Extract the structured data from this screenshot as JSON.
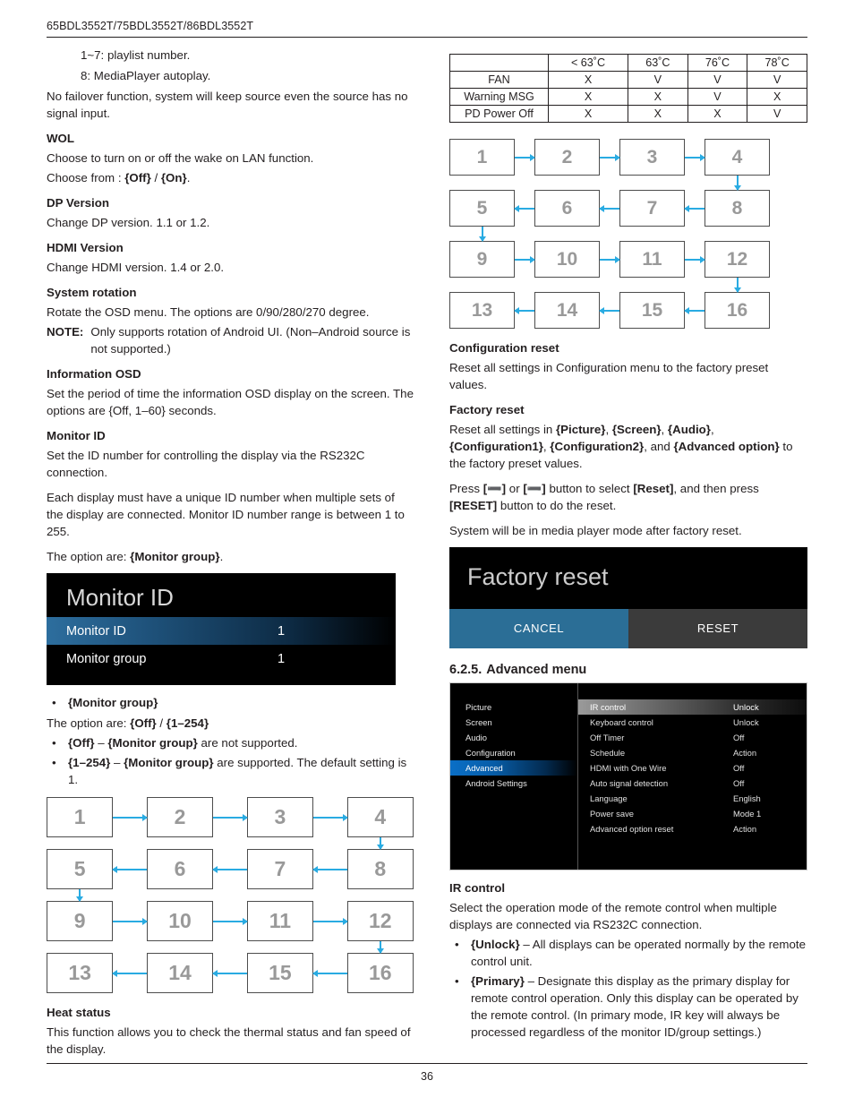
{
  "header": {
    "models": "65BDL3552T/75BDL3552T/86BDL3552T"
  },
  "footer": {
    "page_number": "36"
  },
  "left_column": {
    "playlist_lines": [
      "1~7: playlist number.",
      "8: MediaPlayer autoplay."
    ],
    "failover_note": "No failover function, system will keep source even the source has no signal input.",
    "wol": {
      "heading": "WOL",
      "body": "Choose to turn on or off the wake on LAN function.",
      "choose_prefix": "Choose from : ",
      "choose_off": "{Off}",
      "choose_sep": " / ",
      "choose_on": "{On}",
      "choose_suffix": "."
    },
    "dp_version": {
      "heading": "DP Version",
      "body": "Change DP version. 1.1 or 1.2."
    },
    "hdmi_version": {
      "heading": "HDMI Version",
      "body": "Change HDMI version. 1.4 or 2.0."
    },
    "system_rotation": {
      "heading": "System rotation",
      "body": "Rotate the OSD menu. The options are 0/90/280/270 degree.",
      "note_label": "NOTE:",
      "note_body": "Only supports rotation of Android UI. (Non–Android source is not supported.)"
    },
    "information_osd": {
      "heading": "Information OSD",
      "body": "Set the period of time the information OSD display on the screen. The options are {Off, 1–60} seconds."
    },
    "monitor_id": {
      "heading": "Monitor ID",
      "body1": "Set the ID number for controlling the display via the RS232C connection.",
      "body2": "Each display must have a unique ID number when multiple sets of the display are connected. Monitor ID number range is between 1 to 255.",
      "option_prefix": "The option are: ",
      "option_value": "{Monitor group}",
      "option_suffix": "."
    },
    "monitor_id_osd": {
      "title": "Monitor ID",
      "rows": [
        {
          "label": "Monitor ID",
          "value": "1",
          "selected": true
        },
        {
          "label": "Monitor group",
          "value": "1",
          "selected": false
        }
      ]
    },
    "monitor_group_bullets": {
      "b1": "{Monitor group}",
      "option_prefix": "The option are: ",
      "option_off": "{Off}",
      "option_sep": " / ",
      "option_range": "{1–254}",
      "b2_bold1": "{Off}",
      "b2_dash": " – ",
      "b2_bold2": "{Monitor group}",
      "b2_rest": " are not supported.",
      "b3_bold1": "{1–254}",
      "b3_dash": " – ",
      "b3_bold2": "{Monitor group}",
      "b3_rest": " are supported. The default setting is 1."
    },
    "chain_numbers": [
      "1",
      "2",
      "3",
      "4",
      "5",
      "6",
      "7",
      "8",
      "9",
      "10",
      "11",
      "12",
      "13",
      "14",
      "15",
      "16"
    ],
    "heat_status": {
      "heading": "Heat status",
      "body": "This function allows you to check the thermal status and fan speed of the display."
    }
  },
  "right_column": {
    "temp_table": {
      "headers": [
        "",
        "< 63˚C",
        "63˚C",
        "76˚C",
        "78˚C"
      ],
      "rows": [
        {
          "label": "FAN",
          "values": [
            "X",
            "V",
            "V",
            "V"
          ]
        },
        {
          "label": "Warning MSG",
          "values": [
            "X",
            "X",
            "V",
            "X"
          ]
        },
        {
          "label": "PD Power Off",
          "values": [
            "X",
            "X",
            "X",
            "V"
          ]
        }
      ]
    },
    "chain_numbers": [
      "1",
      "2",
      "3",
      "4",
      "5",
      "6",
      "7",
      "8",
      "9",
      "10",
      "11",
      "12",
      "13",
      "14",
      "15",
      "16"
    ],
    "configuration_reset": {
      "heading": "Configuration reset",
      "body": "Reset all settings in Configuration menu to the factory preset values."
    },
    "factory_reset": {
      "heading": "Factory reset",
      "p1_prefix": "Reset all settings in ",
      "p1_b1": "{Picture}",
      "p1_s1": ", ",
      "p1_b2": "{Screen}",
      "p1_s2": ", ",
      "p1_b3": "{Audio}",
      "p1_s3": ", ",
      "p1_b4": "{Configuration1}",
      "p1_s4": ", ",
      "p1_b5": "{Configuration2}",
      "p1_s5": ", and ",
      "p1_b6": "{Advanced option}",
      "p1_suffix": " to the factory preset values.",
      "p2_prefix": "Press ",
      "p2_key1": "[➖]",
      "p2_mid": " or ",
      "p2_key2": "[➖]",
      "p2_mid2": " button to select ",
      "p2_reset": "[Reset]",
      "p2_mid3": ", and then press ",
      "p2_resetbtn": "[RESET]",
      "p2_suffix": " button to do the reset.",
      "p3": "System will be in media player mode after factory reset."
    },
    "factory_dialog": {
      "title": "Factory reset",
      "cancel_label": "CANCEL",
      "reset_label": "RESET"
    },
    "advanced_menu_heading": {
      "number": "6.2.5.",
      "title": "Advanced menu"
    },
    "advanced_osd": {
      "sidebar": [
        {
          "label": "Picture",
          "active": false
        },
        {
          "label": "Screen",
          "active": false
        },
        {
          "label": "Audio",
          "active": false
        },
        {
          "label": "Configuration",
          "active": false
        },
        {
          "label": "Advanced",
          "active": true
        },
        {
          "label": "Android Settings",
          "active": false
        }
      ],
      "options": [
        {
          "name": "IR control",
          "value": "Unlock",
          "active": true
        },
        {
          "name": "Keyboard control",
          "value": "Unlock",
          "active": false
        },
        {
          "name": "Off Timer",
          "value": "Off",
          "active": false
        },
        {
          "name": "Schedule",
          "value": "Action",
          "active": false
        },
        {
          "name": "HDMI with One Wire",
          "value": "Off",
          "active": false
        },
        {
          "name": "Auto signal detection",
          "value": "Off",
          "active": false
        },
        {
          "name": "Language",
          "value": "English",
          "active": false
        },
        {
          "name": "Power save",
          "value": "Mode 1",
          "active": false
        },
        {
          "name": "Advanced option reset",
          "value": "Action",
          "active": false
        }
      ]
    },
    "ir_control": {
      "heading": "IR control",
      "body": "Select the operation mode of the remote control when multiple displays are connected via RS232C connection.",
      "b1_bold": "{Unlock}",
      "b1_rest": " – All displays can be operated normally by the remote control unit.",
      "b2_bold": "{Primary}",
      "b2_rest": " – Designate this display as the primary display for remote control operation. Only this display can be operated by the remote control. (In primary mode, IR key will always be processed regardless of the monitor ID/group settings.)"
    }
  },
  "colors": {
    "arrow_blue": "#29abe2",
    "osd_highlight_blue": "#0a6fc7",
    "cancel_blue": "#2b6e96",
    "reset_gray": "#3b3b3b",
    "box_number_gray": "#999999"
  }
}
